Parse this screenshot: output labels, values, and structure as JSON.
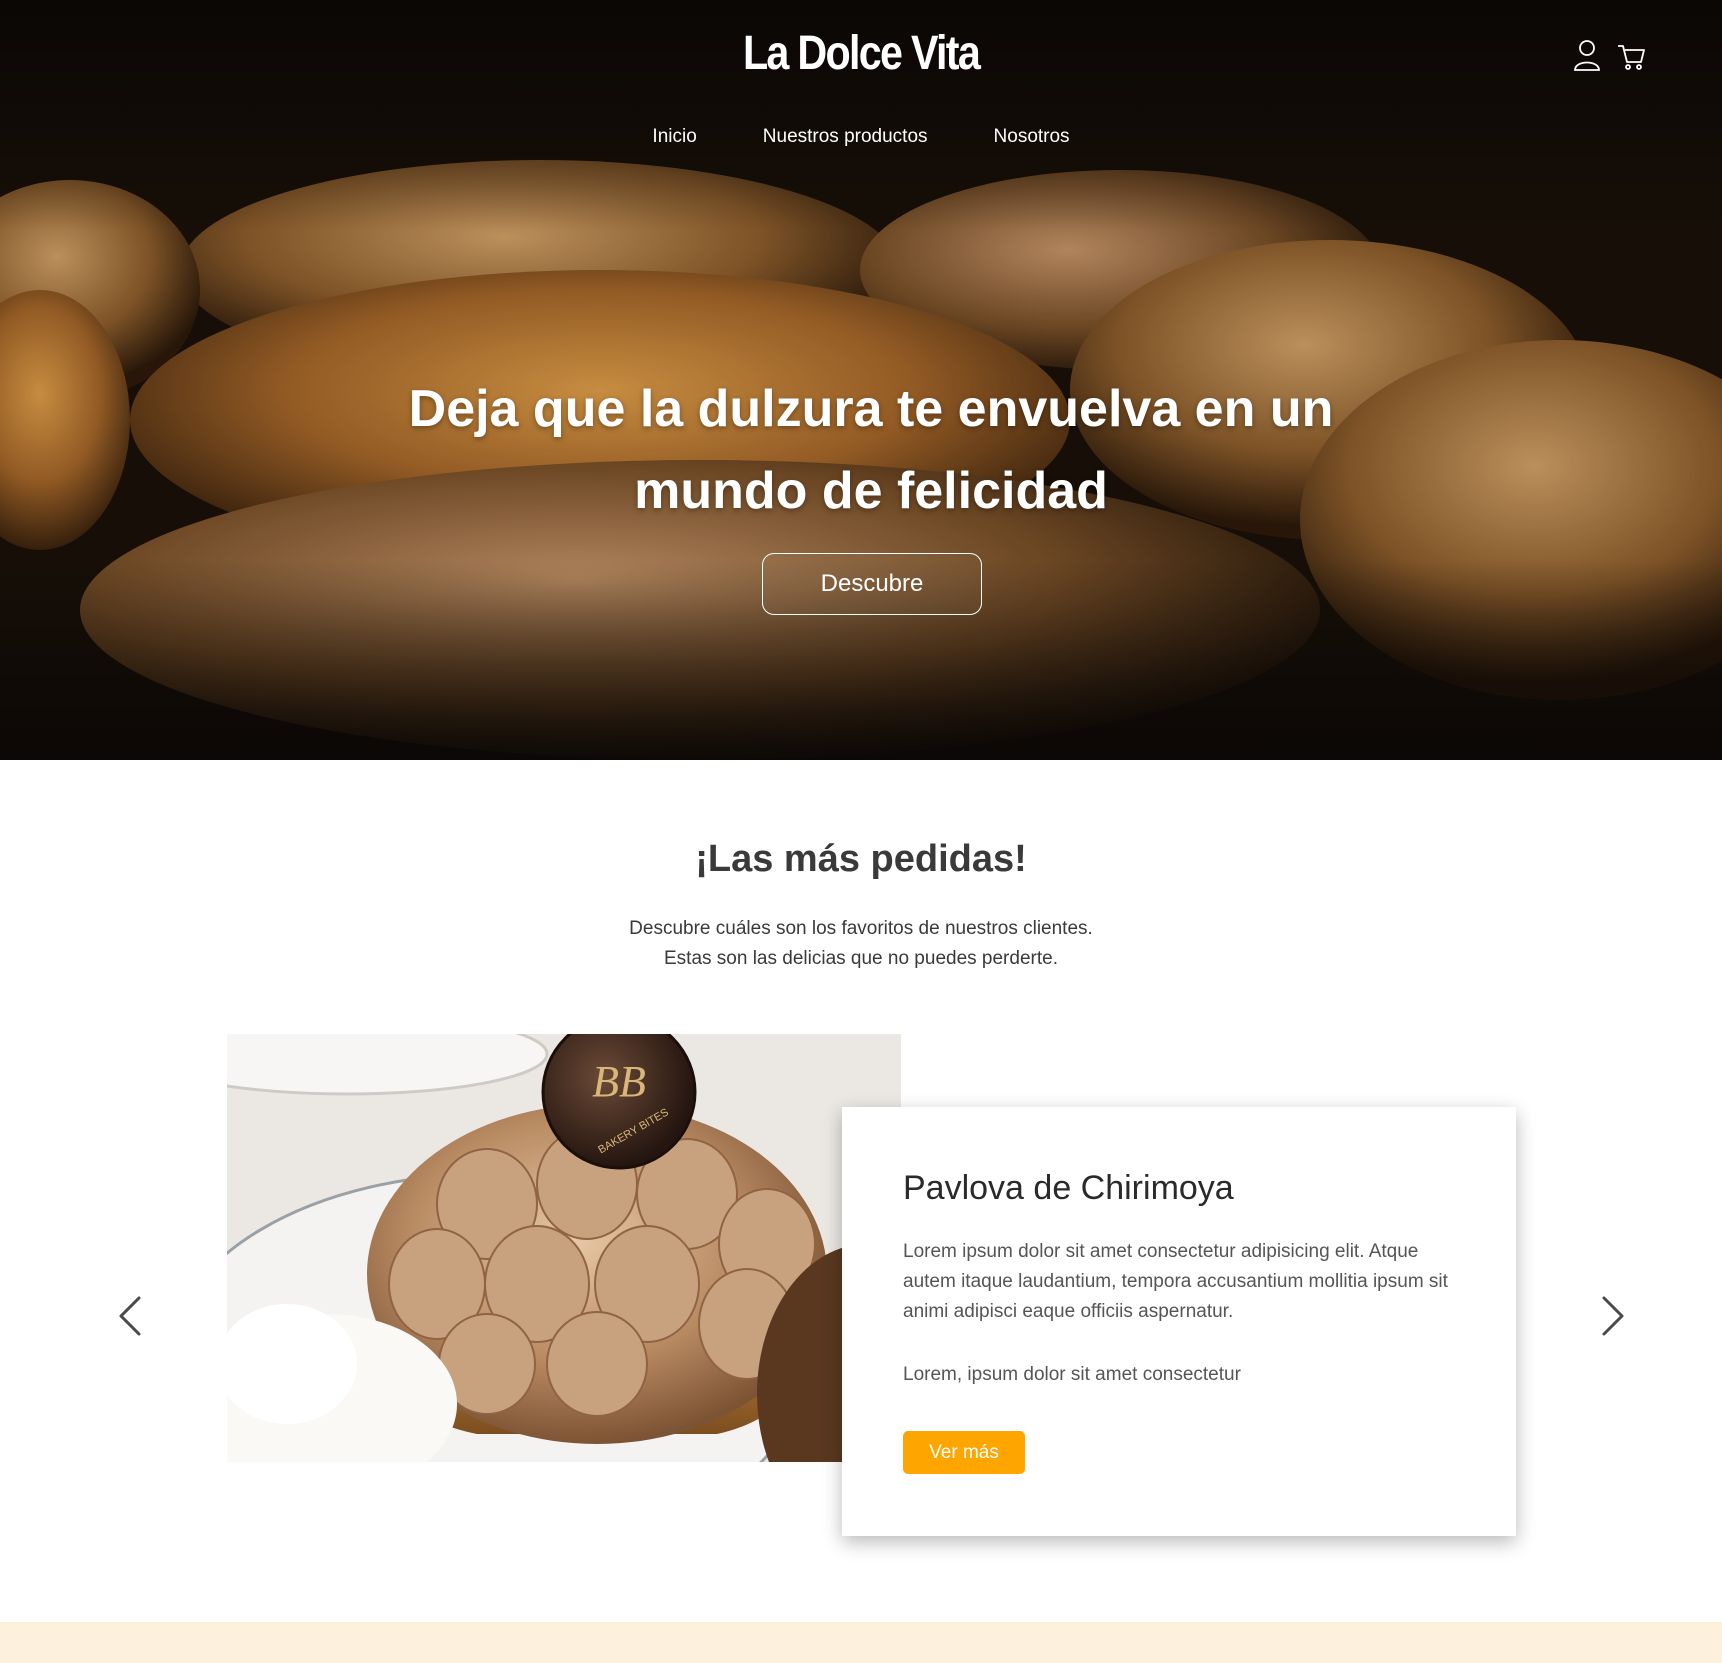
{
  "header": {
    "logo": "La Dolce Vita",
    "icons": [
      "user-icon",
      "cart-icon"
    ]
  },
  "nav": {
    "items": [
      "Inicio",
      "Nuestros productos",
      "Nosotros"
    ]
  },
  "hero": {
    "title": "Deja que la dulzura te envuelva en un mundo de felicidad",
    "button_label": "Descubre"
  },
  "popular": {
    "title": "¡Las más pedidas!",
    "subtitle_line1": "Descubre cuáles son los favoritos de nuestros clientes.",
    "subtitle_line2": "Estas son las delicias que no puedes perderte.",
    "product": {
      "name": "Pavlova de Chirimoya",
      "description": "Lorem ipsum dolor sit amet consectetur adipisicing elit. Atque autem itaque laudantium, tempora accusantium mollitia ipsum sit animi adipisci eaque officiis aspernatur.",
      "extra": "Lorem, ipsum dolor sit amet consectetur",
      "button_label": "Ver más",
      "image_logo_text": "BAKERY BITES"
    },
    "arrows": [
      "chevron-left-icon",
      "chevron-right-icon"
    ]
  },
  "colors": {
    "accent": "#ffa500",
    "heading": "#3a3a3a",
    "footer_band": "#fdf0dc"
  }
}
